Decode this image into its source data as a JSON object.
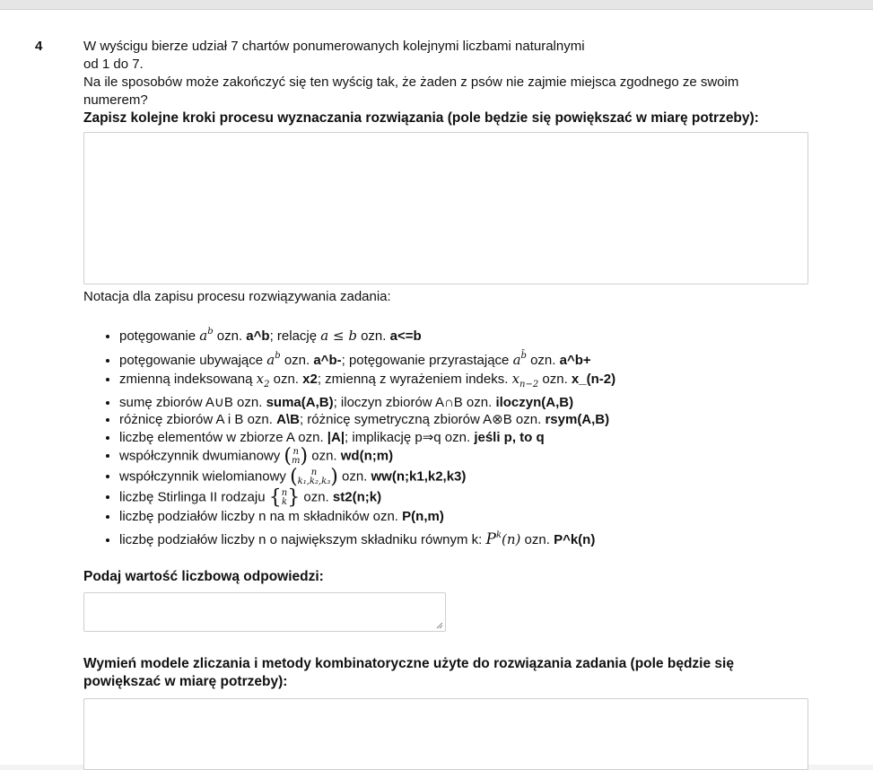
{
  "question": {
    "number": "4",
    "text_lines": [
      "W wyścigu bierze udział 7 chartów ponumerowanych kolejnymi liczbami naturalnymi",
      "od 1 do 7.",
      "Na ile sposobów może zakończyć się ten wyścig tak, że żaden z psów nie zajmie miejsca zgodnego ze swoim",
      "numerem?"
    ],
    "steps_label": "Zapisz kolejne kroki procesu wyznaczania rozwiązania (pole będzie się powiększać w miarę potrzeby):",
    "steps_value": ""
  },
  "notation": {
    "title": "Notacja dla zapisu procesu rozwiązywania zadania:",
    "items": {
      "i1": {
        "t1": "potęgowanie ",
        "m1": "a",
        "s1": "b",
        "t2": " ozn. ",
        "c1": "a^b",
        "t3": ";   relację ",
        "m2": "a ≤ b",
        "t4": " ozn. ",
        "c2": "a<=b"
      },
      "i2": {
        "t1": "potęgowanie ubywające ",
        "m1": "a",
        "s1": "b",
        "t2": " ozn. ",
        "c1": "a^b-",
        "t3": ";  potęgowanie przyrastające ",
        "m2": "a",
        "s2": "b̄",
        "t4": " ozn. ",
        "c2": "a^b+"
      },
      "i3": {
        "t1": "zmienną indeksowaną ",
        "m1": "x",
        "s1": "2",
        "t2": " ozn. ",
        "c1": "x2",
        "t3": ";  zmienną z wyrażeniem indeks. ",
        "m2": "x",
        "s2": "n−2",
        "t4": " ozn. ",
        "c2": "x_(n-2)"
      },
      "i4": {
        "t1": "sumę zbiorów A∪B ozn. ",
        "c1": "suma(A,B)",
        "t2": ";   iloczyn zbiorów A∩B ozn. ",
        "c2": "iloczyn(A,B)"
      },
      "i5": {
        "t1": "różnicę zbiorów A i B ozn. ",
        "c1": "A\\B",
        "t2": ";   różnicę symetryczną zbiorów A⊗B ozn. ",
        "c2": "rsym(A,B)"
      },
      "i6": {
        "t1": "liczbę elementów w zbiorze A ozn. ",
        "c1": "|A|",
        "t2": ";   implikację p⇒q ozn. ",
        "c2": "jeśli p, to q"
      },
      "i7": {
        "t1": "współczynnik dwumianowy ",
        "top": "n",
        "bot": "m",
        "t2": " ozn. ",
        "c1": "wd(n;m)"
      },
      "i8": {
        "t1": "współczynnik wielomianowy ",
        "top": "n",
        "bot": "k₁,k₂,k₃",
        "t2": " ozn. ",
        "c1": "ww(n;k1,k2,k3)"
      },
      "i9": {
        "t1": "liczbę Stirlinga II rodzaju ",
        "top": "n",
        "bot": "k",
        "t2": " ozn. ",
        "c1": "st2(n;k)"
      },
      "i10": {
        "t1": "liczbę podziałów liczby n na m składników ozn. ",
        "c1": "P(n,m)"
      },
      "i11": {
        "t1": "liczbę podziałów liczby n o największym składniku równym k: ",
        "m1": "P",
        "s1": "k",
        "m2": "(n)",
        "t2": " ozn. ",
        "c1": "P^k(n)"
      }
    }
  },
  "answer": {
    "label": "Podaj wartość liczbową odpowiedzi:",
    "value": ""
  },
  "models": {
    "label_line1": "Wymień modele zliczania i metody kombinatoryczne użyte do rozwiązania zadania (pole będzie się",
    "label_line2": "powiększać w miarę potrzeby):",
    "value": ""
  }
}
